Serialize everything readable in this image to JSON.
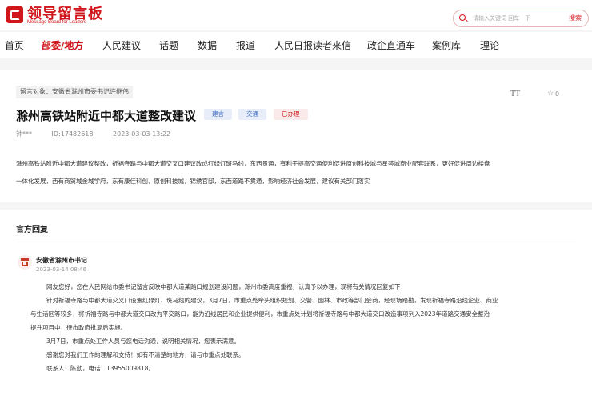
{
  "header": {
    "logo_title": "领导留言板",
    "logo_subtitle": "Message Board for Leaders",
    "search_placeholder": "请输入关键词 回车一下",
    "search_button": "搜索"
  },
  "nav": {
    "items": [
      {
        "label": "首页"
      },
      {
        "label": "部委/地方"
      },
      {
        "label": "人民建议"
      },
      {
        "label": "话题"
      },
      {
        "label": "数据"
      },
      {
        "label": "报道"
      },
      {
        "label": "人民日报读者来信"
      },
      {
        "label": "政企直通车"
      },
      {
        "label": "案例库"
      },
      {
        "label": "理论"
      }
    ],
    "active": "部委/地方"
  },
  "message": {
    "target": "留言对象：安徽省滁州市委书记许继伟",
    "title": "滁州高铁站附近中都大道整改建议",
    "tags": {
      "type": "建言",
      "field": "交通",
      "status": "已办理"
    },
    "font_icon": "TT",
    "star_count": "0",
    "author": "钟***",
    "id": "ID:17482618",
    "date": "2023-03-03 13:22",
    "body_line1": "滁州高铁站附近中都大道建议整改，祈福寺路与中都大道交叉口建议改成红绿灯斑马线，东西贯通，有利于提高交通便利促进原创科技城与星荟城商业配套联系，更好促进周边楼盘",
    "body_line2": "一体化发展，西有商贸城金城学府，东有康佳科创，原创科技城，锦绣官邸，东西道路不贯通，影响经济社会发展，建议有关部门落实"
  },
  "reply": {
    "section_title": "官方回复",
    "org": "安徽省滁州市书记",
    "date": "2023-03-14 08:46",
    "p1": "网友您好，您在人民网给市委书记留言反映中都大道某路口规划建设问题，滁州市委高度重视，认真予以办理，现将有关情况回复如下：",
    "p2a": "针对祈福寺路与中都大道交叉口设置红绿灯、斑马线的建议，3月7日，市重点处牵头组织规划、交警、园林、市政等部门会商，经现场踏勘，发现祈福寺路沿线企业、商业",
    "p2b": "与生活区等较多，将祈福寺路与中都大道交口改为平交路口，能为沿线居民和企业提供便利，市重点处计划将祈福寺路与中都大道交口改造事项列入2023年道路交通安全整治",
    "p2c": "提升项目中，待市政府批复后实施。",
    "p3": "3月7日，市重点处工作人员与您电话沟通，说明相关情况，您表示满意。",
    "p4": "感谢您对我们工作的理解和支持！如有不清楚的地方，请与市重点处联系。",
    "p5": "联系人：陈勤，电话：13955009818。"
  },
  "colors": {
    "brand": "#d0161b",
    "tag_blue": "#3f6fc6",
    "background": "#f5f5f5"
  },
  "icons": [
    "logo-icon",
    "search-icon",
    "font-size-icon",
    "star-icon",
    "government-building-icon"
  ]
}
